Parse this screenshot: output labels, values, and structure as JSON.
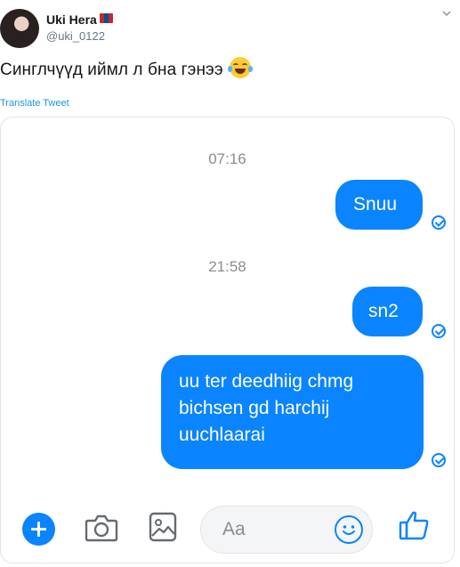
{
  "tweet": {
    "display_name": "Uki Hera",
    "handle": "@uki_0122",
    "text": "Синглчүүд иймл л бна гэнээ",
    "translate_label": "Translate Tweet",
    "icons": {
      "flag": "mongolia-flag-icon",
      "emoji": "tears-of-joy-emoji-icon",
      "caret": "chevron-down-icon"
    }
  },
  "chat": {
    "accent_color": "#0a84ff",
    "timestamps": [
      "07:16",
      "21:58"
    ],
    "messages": [
      {
        "text": "Snuu",
        "status": "sent"
      },
      {
        "text": "sn2",
        "status": "sent"
      },
      {
        "lines": [
          "uu ter deedhiig chmg",
          "bichsen gd harchij",
          "uuchlaarai"
        ],
        "status": "sent"
      }
    ],
    "composer": {
      "placeholder": "Aa",
      "icons": [
        "plus-icon",
        "camera-icon",
        "gallery-icon",
        "emoji-icon",
        "thumbs-up-icon"
      ]
    }
  }
}
